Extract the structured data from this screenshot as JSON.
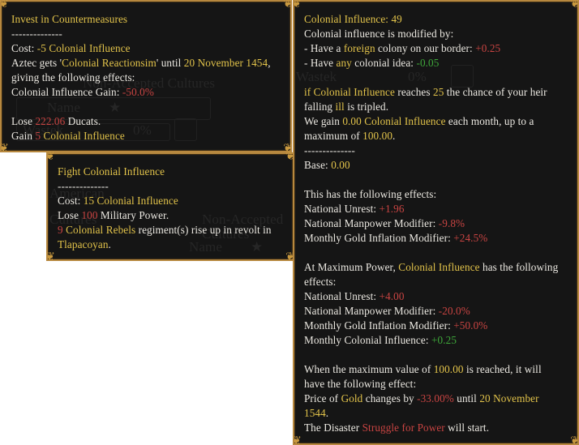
{
  "tooltips": {
    "invest": {
      "title": "Invest in Countermeasures",
      "separator": "--------------",
      "cost_label": "Cost: ",
      "cost_value": "-5 Colonial Influence",
      "gets_prefix": "Aztec gets '",
      "modifier_name": "Colonial Reactionsim",
      "gets_mid": "' until ",
      "until_date": "20 November 1454",
      "gets_suffix": ",",
      "effects_intro": "giving the following effects:",
      "gain_label": "Colonial Influence Gain: ",
      "gain_value": "-50.0%",
      "lose_prefix": "Lose ",
      "lose_value": "222.06",
      "lose_suffix": " Ducats.",
      "gain_prefix": "Gain ",
      "gain_amount": "5",
      "gain_unit": " Colonial Influence"
    },
    "fight": {
      "title": "Fight Colonial Influence",
      "separator": "--------------",
      "cost_label": "Cost: ",
      "cost_value": "15 Colonial Influence",
      "lose_prefix": "Lose ",
      "lose_value": "100",
      "lose_suffix": " Military Power.",
      "rebels_count": "9",
      "rebels_type": " Colonial Rebels",
      "rebels_text": " regiment(s) rise up in revolt in",
      "province": "Tlapacoyan",
      "province_suffix": "."
    },
    "colonial": {
      "title": "Colonial Influence: 49",
      "modified_by": "Colonial influence is modified by:",
      "mod1_prefix": "- Have a ",
      "mod1_key": "foreign",
      "mod1_suffix": " colony on our border: ",
      "mod1_value": "+0.25",
      "mod2_prefix": "- Have ",
      "mod2_key": "any",
      "mod2_suffix": " colonial idea: ",
      "mod2_value": "-0.05",
      "heir_if": "if ",
      "heir_key": "Colonial Influence",
      "heir_mid": " reaches ",
      "heir_threshold": "25",
      "heir_suffix": " the chance of your heir",
      "heir_line2_prefix": "falling ",
      "heir_ill": "ill",
      "heir_line2_suffix": " is tripled.",
      "gain_prefix": "We gain ",
      "gain_value": "0.00 Colonial Influence",
      "gain_suffix": " each month, up to a",
      "max_prefix": "maximum of ",
      "max_value": "100.00",
      "max_suffix": ".",
      "separator": "--------------",
      "base_label": "Base: ",
      "base_value": "0.00",
      "effects_intro": "This has the following effects:",
      "effects": [
        {
          "label": "National Unrest: ",
          "value": "+1.96"
        },
        {
          "label": "National Manpower Modifier: ",
          "value": "-9.8%"
        },
        {
          "label": "Monthly Gold Inflation Modifier: ",
          "value": "+24.5%"
        }
      ],
      "atmax_prefix": "At Maximum Power, ",
      "atmax_key": "Colonial Influence",
      "atmax_suffix": " has the following",
      "atmax_line2": "effects:",
      "max_effects": [
        {
          "label": "National Unrest: ",
          "value": "+4.00",
          "tone": "negative"
        },
        {
          "label": "National Manpower Modifier: ",
          "value": "-20.0%",
          "tone": "negative"
        },
        {
          "label": "Monthly Gold Inflation Modifier: ",
          "value": "+50.0%",
          "tone": "negative"
        },
        {
          "label": "Monthly Colonial Influence: ",
          "value": "+0.25",
          "tone": "positive"
        }
      ],
      "reach_prefix": "When the maximum value of ",
      "reach_value": "100.00",
      "reach_suffix": " is reached, it will",
      "reach_line2": "have the following effect:",
      "price_prefix": "Price of ",
      "price_good": "Gold",
      "price_mid": " changes by ",
      "price_value": "-33.00%",
      "price_until": " until ",
      "price_date1": "20 November",
      "price_date2": "1544",
      "price_end": ".",
      "disaster_prefix": "The Disaster ",
      "disaster_name": "Struggle for Power",
      "disaster_suffix": " will start."
    }
  },
  "background_ghost": {
    "header": "Non-Accepted Cultures",
    "name_col": "Name",
    "row_name": "Wastek",
    "row_pct": "0%",
    "header2": "Non-Accepted Cultures",
    "name_col2": "Name",
    "american_label": "American",
    "cultures_label": "Cultures"
  },
  "colors": {
    "highlight_yellow": "#e2c34a",
    "negative_red": "#c94442",
    "positive_green": "#3ea83a",
    "text_white": "#ece9e2",
    "border_gold": "#b7883f",
    "panel_bg": "#151515"
  }
}
